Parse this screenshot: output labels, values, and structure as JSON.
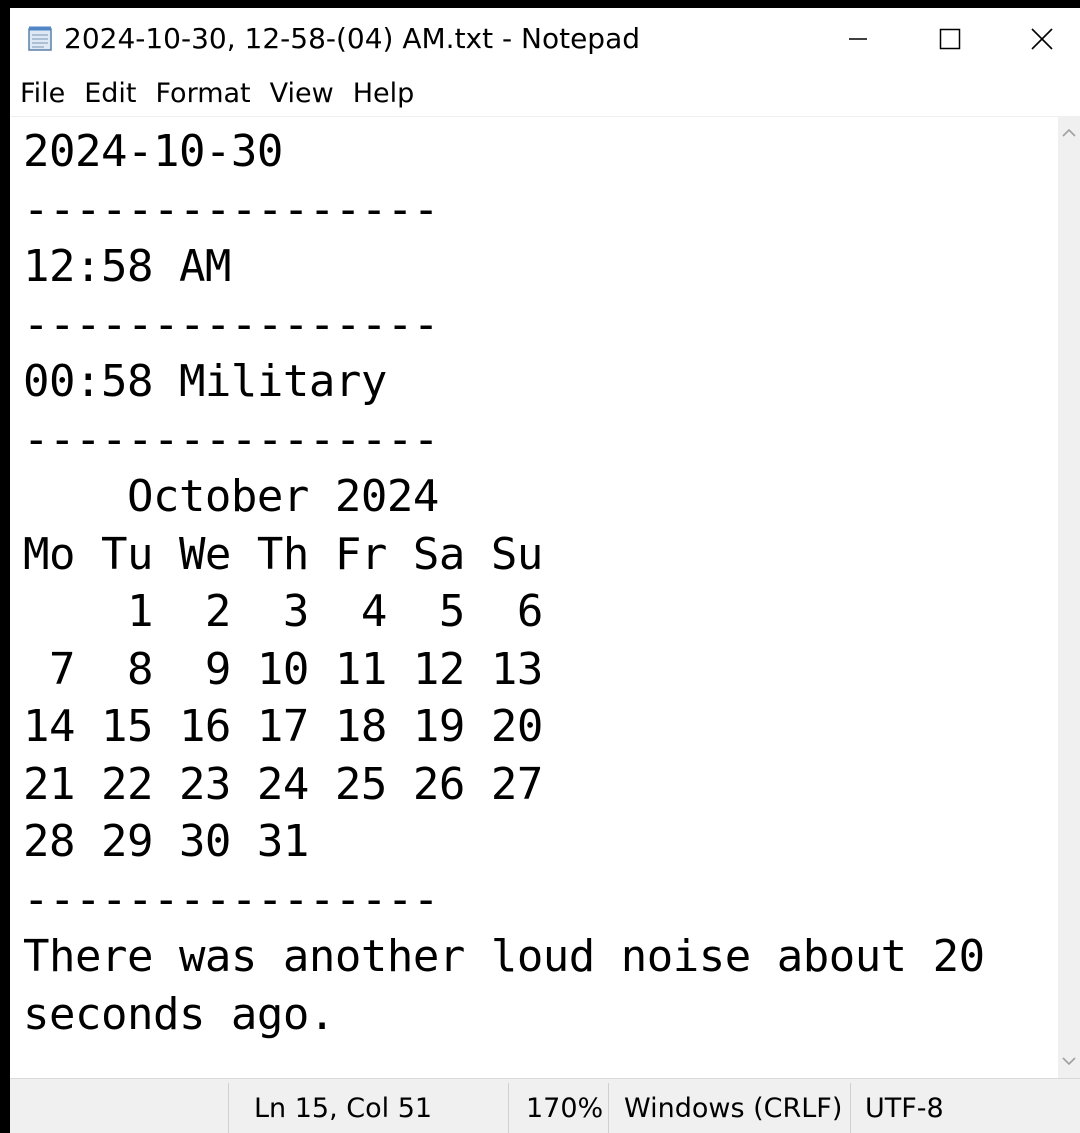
{
  "window": {
    "title": "2024-10-30, 12-58-(04) AM.txt - Notepad",
    "icon": "notepad-icon",
    "controls": {
      "minimize_icon": "minimize-icon",
      "maximize_icon": "maximize-icon",
      "close_icon": "close-icon"
    }
  },
  "menu": {
    "items": [
      "File",
      "Edit",
      "Format",
      "View",
      "Help"
    ]
  },
  "editor": {
    "content": "2024-10-30\n----------------\n12:58 AM\n----------------\n00:58 Military\n----------------\n    October 2024\nMo Tu We Th Fr Sa Su\n    1  2  3  4  5  6\n 7  8  9 10 11 12 13\n14 15 16 17 18 19 20\n21 22 23 24 25 26 27\n28 29 30 31\n----------------\nThere was another loud noise about 20\nseconds ago."
  },
  "statusbar": {
    "position": "Ln 15, Col 51",
    "zoom": "170%",
    "line_ending": "Windows (CRLF)",
    "encoding": "UTF-8"
  },
  "colors": {
    "window_bg": "#ffffff",
    "chrome_bg": "#f0f0f0",
    "outer_bg": "#000000",
    "text": "#000000"
  }
}
